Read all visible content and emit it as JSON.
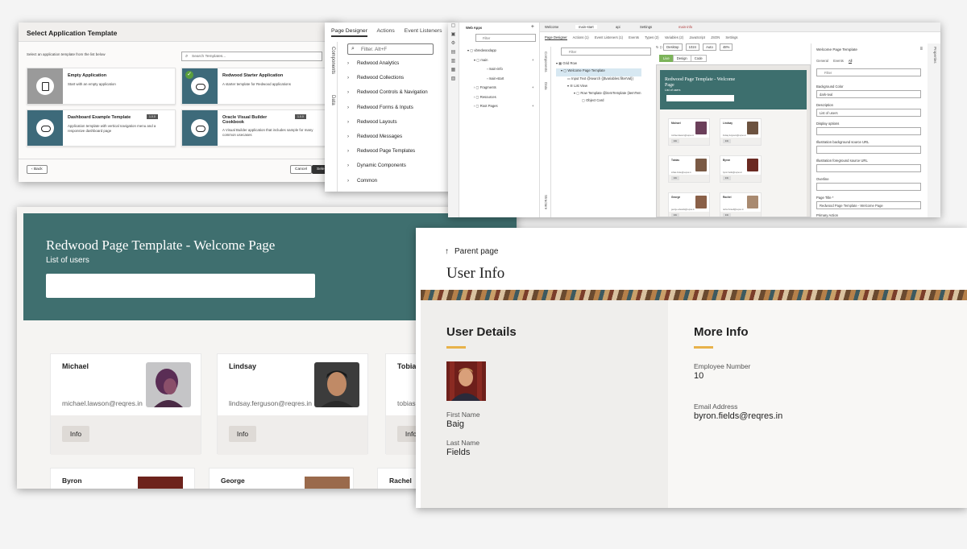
{
  "select_template": {
    "title": "Select Application Template",
    "subtitle": "Select an application template from the list below",
    "search_placeholder": "Search Templates...",
    "cards": [
      {
        "title": "Empty Application",
        "desc": "Start with an empty application",
        "tag": ""
      },
      {
        "title": "Redwood Starter Application",
        "desc": "A starter template for Redwood applications",
        "tag": ""
      },
      {
        "title": "Dashboard Example Template",
        "desc": "Application template with vertical navigation menu and a responsive dashboard page",
        "tag": "1.0.0"
      },
      {
        "title": "Oracle Visual Builder Cookbook",
        "desc": "A Visual Builder application that includes sample for many common usecases",
        "tag": "1.0.0"
      }
    ],
    "back_label": "Back",
    "cancel_label": "Cancel",
    "select_label": "Sele"
  },
  "component_palette": {
    "tabs": [
      "Page Designer",
      "Actions",
      "Event Listeners"
    ],
    "side_tabs": [
      "Components",
      "Data"
    ],
    "filter_placeholder": "Filter.  Alt+F",
    "items": [
      "Redwood Analytics",
      "Redwood Collections",
      "Redwood Controls & Navigation",
      "Redwood Forms & Inputs",
      "Redwood Layouts",
      "Redwood Messages",
      "Redwood Page Templates",
      "Dynamic Components",
      "Common"
    ]
  },
  "designer": {
    "nav_title": "Web Apps",
    "nav_filter": "Filter",
    "nav_tree": [
      "vbredwoodapp",
      "main",
      "main-info",
      "main-start",
      "Fragments",
      "Resources",
      "Root Pages"
    ],
    "tabs": [
      "Welcome",
      "main-start",
      "api",
      "Settings",
      "main-info"
    ],
    "subtabs": [
      "Page Designer",
      "Actions (1)",
      "Event Listeners (1)",
      "Events",
      "Types (2)",
      "Variables (2)",
      "JavaScript",
      "JSON",
      "Settings"
    ],
    "side_tabs": [
      "Components",
      "Data",
      "Structure"
    ],
    "structure_filter": "Filter",
    "structure_tree": [
      "Grid Row",
      "Welcome Page Template",
      "Input Text  @search {{$variables.filterVal}}",
      "List View",
      "Row Template  @itemTemplate  {itemTem",
      "Object Card"
    ],
    "device": "Desktop",
    "width": "1024",
    "auto": "Auto",
    "zoom": "48%",
    "modes": [
      "Live",
      "Design",
      "Code"
    ],
    "canvas_title": "Redwood Page Template - Welcome Page",
    "canvas_subtitle": "List of users",
    "mini_cards": [
      {
        "name": "Michael",
        "email": "michael.lawson@reqres.in",
        "btn": "Info"
      },
      {
        "name": "Lindsay",
        "email": "lindsay.ferguson@reqres.in",
        "btn": "Info"
      },
      {
        "name": "Tobias",
        "email": "tobias.funke@reqres.in",
        "btn": "Info"
      },
      {
        "name": "Byron",
        "email": "byron.fields@reqres.in",
        "btn": "Info"
      },
      {
        "name": "George",
        "email": "george.edwards@reqres.in",
        "btn": "Info"
      },
      {
        "name": "Rachel",
        "email": "rachel.howell@reqres.in",
        "btn": "Info"
      }
    ],
    "props_title": "Welcome Page Template",
    "props_tabs": [
      "General",
      "Events",
      "All"
    ],
    "props_filter": "Filter",
    "props_fields": [
      {
        "label": "Background Color",
        "value": "dark-teal"
      },
      {
        "label": "Description",
        "value": "List of users"
      },
      {
        "label": "Display options",
        "value": ""
      },
      {
        "label": "Illustration background source URL",
        "value": ""
      },
      {
        "label": "Illustration foreground source URL",
        "value": ""
      },
      {
        "label": "Overline",
        "value": ""
      },
      {
        "label": "Page Title  *",
        "value": "Redwood Page Template - Welcome Page"
      },
      {
        "label": "Primary Action",
        "value": ""
      }
    ],
    "right_tab": "Properties"
  },
  "welcome_page": {
    "title": "Redwood Page Template - Welcome Page",
    "subtitle": "List of users",
    "cards": [
      {
        "name": "Michael",
        "email": "michael.lawson@reqres.in",
        "btn": "Info"
      },
      {
        "name": "Lindsay",
        "email": "lindsay.ferguson@reqres.in",
        "btn": "Info"
      },
      {
        "name": "Tobias",
        "email": "tobias",
        "btn": "Info"
      }
    ],
    "more_cards": [
      "Byron",
      "George",
      "Rachel"
    ]
  },
  "user_info": {
    "back_label": "Parent page",
    "title": "User Info",
    "left_heading": "User Details",
    "right_heading": "More Info",
    "first_name_label": "First Name",
    "first_name": "Baig",
    "last_name_label": "Last Name",
    "last_name": "Fields",
    "employee_number_label": "Employee Number",
    "employee_number": "10",
    "email_label": "Email Address",
    "email": "byron.fields@reqres.in",
    "accent_color": "#e8b24a"
  }
}
